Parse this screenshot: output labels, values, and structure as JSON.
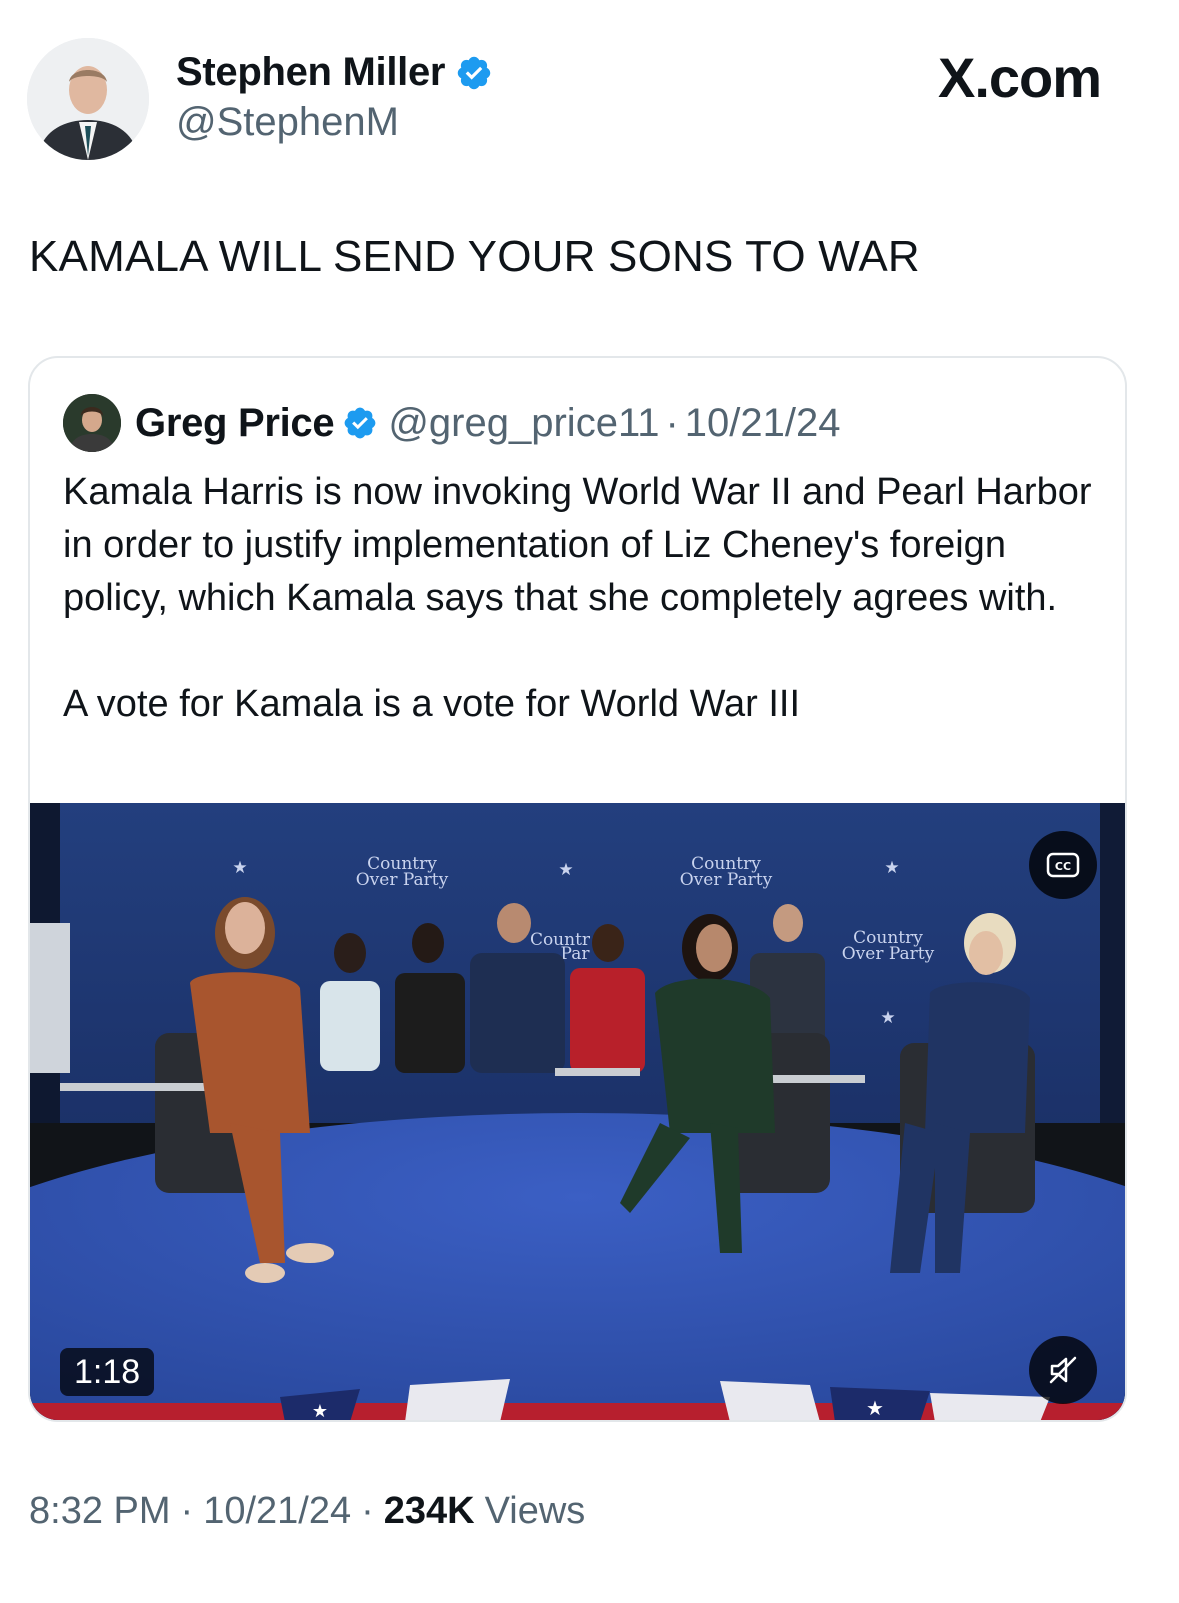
{
  "post": {
    "author_name": "Stephen Miller",
    "author_handle": "@StephenM",
    "text": "KAMALA WILL SEND YOUR SONS TO WAR",
    "time": "8:32 PM",
    "date": "10/21/24",
    "views_count": "234K",
    "views_label": "Views"
  },
  "brand": {
    "site": "X.com"
  },
  "quote": {
    "author_name": "Greg Price",
    "author_handle": "@greg_price11",
    "separator": "·",
    "date": "10/21/24",
    "paragraph1": "Kamala Harris is now invoking World War II and Pearl Harbor in order to justify implementation of Liz Cheney's foreign policy, which Kamala says that she completely agrees with.",
    "paragraph2": "A vote for Kamala is a vote for World War III"
  },
  "video": {
    "duration": "1:18",
    "backdrop_text_line1": "Country",
    "backdrop_text_line2": "Over Party",
    "backdrop_partial_line1": "Countr",
    "backdrop_partial_line2": "Par",
    "cc_label": "CC"
  },
  "colors": {
    "verified_blue": "#1d9bf0",
    "secondary_text": "#536471",
    "primary_text": "#0f1419",
    "stage_blue": "#2f4fb0",
    "backdrop_blue": "#22407f"
  },
  "icons": {
    "verified": "verified-badge-icon",
    "cc": "closed-captions-icon",
    "mute": "speaker-muted-icon"
  }
}
